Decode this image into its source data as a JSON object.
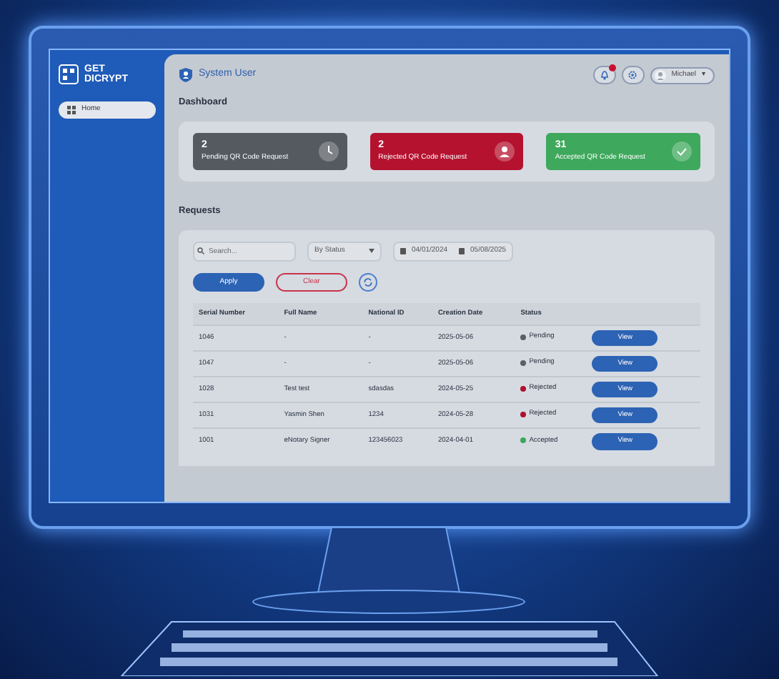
{
  "sidebar": {
    "logo": [
      "GET",
      "DICRYPT"
    ],
    "items": [
      {
        "label": "Home",
        "selected": true
      }
    ]
  },
  "header": {
    "title": "System User",
    "notification": true,
    "user": "Michael",
    "caret": "▾"
  },
  "dashboard": {
    "title": "Dashboard",
    "stats": [
      {
        "kind": "pending",
        "count": "2",
        "label": "Pending QR Code Request"
      },
      {
        "kind": "rejected",
        "count": "2",
        "label": "Rejected QR Code Request"
      },
      {
        "kind": "accepted",
        "count": "31",
        "label": "Accepted QR Code Request"
      }
    ]
  },
  "requests": {
    "title": "Requests",
    "search": {
      "placeholder": "Search..."
    },
    "status_filter": "By Status",
    "date_from": "04/01/2024",
    "date_to": "05/08/2025",
    "buttons": [
      {
        "kind": "primary",
        "label": "Apply"
      },
      {
        "kind": "outline",
        "label": "Clear"
      }
    ],
    "table": {
      "columns": [
        "Serial Number",
        "Full Name",
        "National ID",
        "Creation Date",
        "Status"
      ],
      "rows": [
        {
          "cells": [
            "1046",
            "-",
            "-",
            "2025-05-06"
          ],
          "status": "Pending",
          "color": "#5a5f66",
          "action": "View"
        },
        {
          "cells": [
            "1047",
            "-",
            "-",
            "2025-05-06"
          ],
          "status": "Pending",
          "color": "#5a5f66",
          "action": "View"
        },
        {
          "cells": [
            "1028",
            "Test test",
            "sdasdas",
            "2024-05-25"
          ],
          "status": "Rejected",
          "color": "#b0102e",
          "action": "View"
        },
        {
          "cells": [
            "1031",
            "Yasmin Shen",
            "1234",
            "2024-05-28"
          ],
          "status": "Rejected",
          "color": "#b0102e",
          "action": "View"
        },
        {
          "cells": [
            "1001",
            "eNotary Signer",
            "123456023",
            "2024-04-01"
          ],
          "status": "Accepted",
          "color": "#3aa85a",
          "action": "View"
        }
      ]
    }
  }
}
